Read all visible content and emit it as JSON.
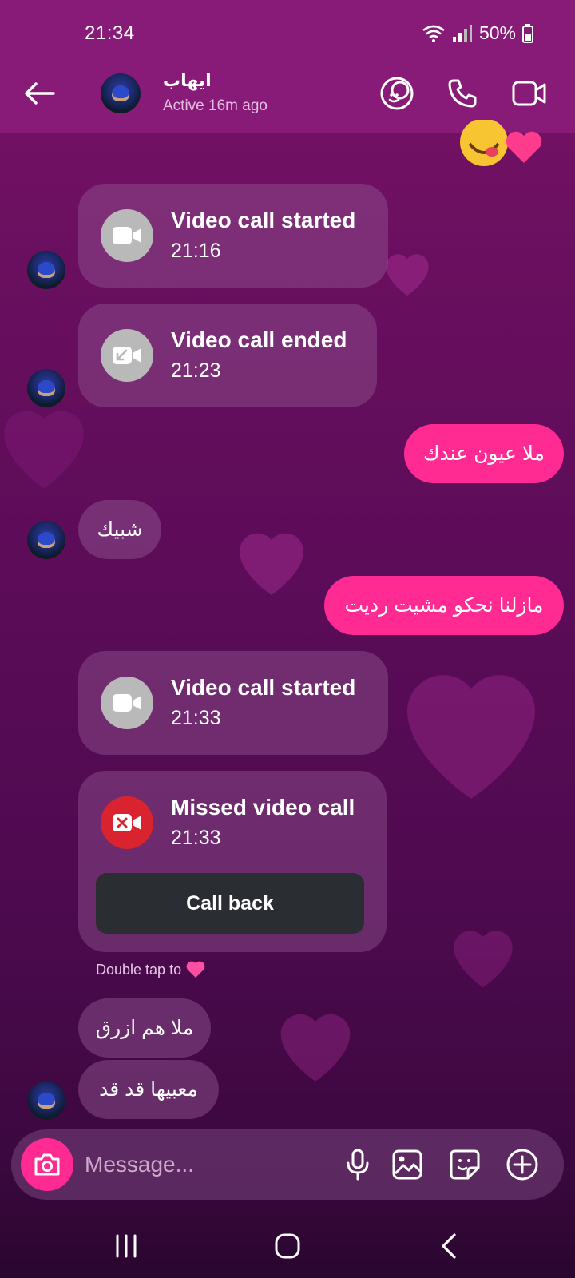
{
  "status_bar": {
    "time": "21:34",
    "battery": "50%"
  },
  "header": {
    "name": "ايهاب",
    "status": "Active 16m ago"
  },
  "messages": {
    "call1": {
      "title": "Video call started",
      "time": "21:16"
    },
    "call2": {
      "title": "Video call ended",
      "time": "21:23"
    },
    "out1": "ملا عيون عندك",
    "in1": "شبيك",
    "out2": "مازلنا نحكو مشيت رديت",
    "call3": {
      "title": "Video call started",
      "time": "21:33"
    },
    "call4": {
      "title": "Missed video call",
      "time": "21:33",
      "button": "Call back"
    },
    "double_tap": "Double tap to",
    "in2": "ملا هم ازرق",
    "in3": "معبيها قد قد"
  },
  "composer": {
    "placeholder": "Message..."
  },
  "colors": {
    "header_bg": "#881b78",
    "outgoing_bubble": "#ff2a92",
    "missed_icon": "#d9242f",
    "callback_button": "#2a2d31"
  }
}
